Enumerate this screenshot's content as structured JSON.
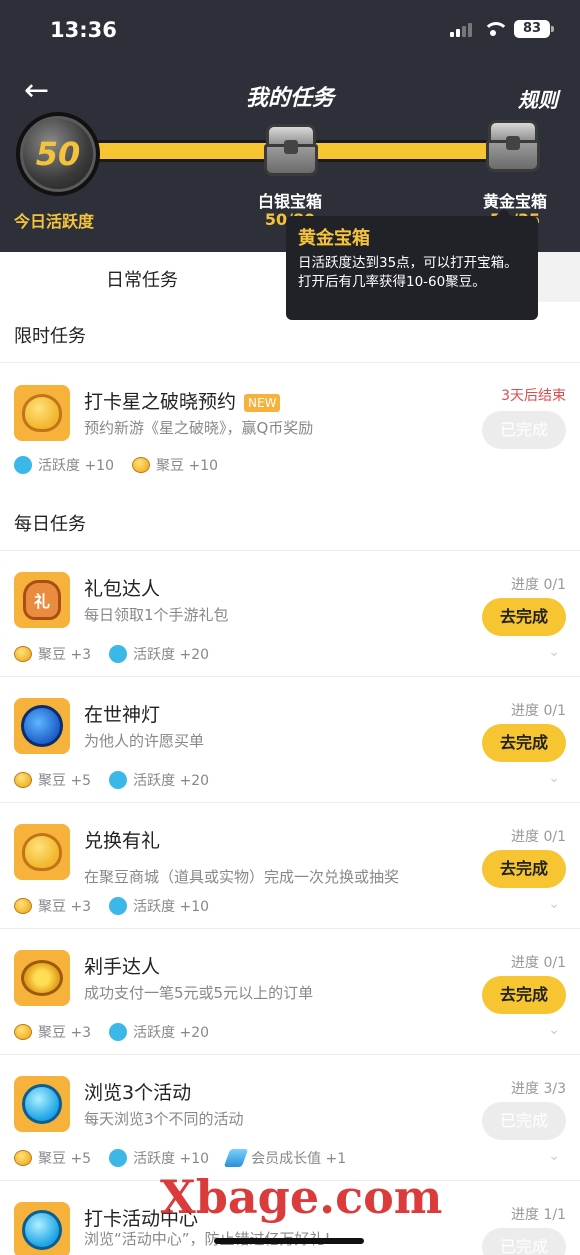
{
  "status": {
    "time": "13:36",
    "battery": "83"
  },
  "nav": {
    "back_icon": "arrow-left-icon",
    "title": "我的任务",
    "rules": "规则"
  },
  "progress_bar": {
    "level": "50",
    "level_label": "今日活跃度",
    "fill_fraction": 1.0,
    "chests": [
      {
        "label": "白银宝箱",
        "sub": "50/80"
      },
      {
        "label": "黄金宝箱",
        "sub": "56/35"
      }
    ]
  },
  "tooltip": {
    "title": "黄金宝箱",
    "body": "日活跃度达到35点，可以打开宝箱。打开后有几率获得10-60聚豆。"
  },
  "tabs": [
    {
      "label": "日常任务"
    }
  ],
  "sections": {
    "limited": "限时任务",
    "daily": "每日任务"
  },
  "limited_task": {
    "title": "打卡星之破晓预约",
    "tag": "NEW",
    "desc": "预约新游《星之破晓》，赢Q币奖励",
    "end": "3天后结束",
    "button": "已完成",
    "rewards": [
      "活跃度 +10",
      "聚豆 +10"
    ]
  },
  "daily_tasks": [
    {
      "title": "礼包达人",
      "desc": "每日领取1个手游礼包",
      "progress": "进度 0/1",
      "button": "去完成",
      "rewards": [
        "聚豆 +3",
        "活跃度 +20"
      ],
      "icon_text": "礼"
    },
    {
      "title": "在世神灯",
      "desc": "为他人的许愿买单",
      "progress": "进度 0/1",
      "button": "去完成",
      "rewards": [
        "聚豆 +5",
        "活跃度 +20"
      ]
    },
    {
      "title": "兑换有礼",
      "desc": "在聚豆商城（道具或实物）完成一次兑换或抽奖",
      "progress": "进度 0/1",
      "button": "去完成",
      "rewards": [
        "聚豆 +3",
        "活跃度 +10"
      ]
    },
    {
      "title": "剁手达人",
      "desc": "成功支付一笔5元或5元以上的订单",
      "progress": "进度 0/1",
      "button": "去完成",
      "rewards": [
        "聚豆 +3",
        "活跃度 +20"
      ]
    },
    {
      "title": "浏览3个活动",
      "desc": "每天浏览3个不同的活动",
      "progress": "进度 3/3",
      "button": "已完成",
      "rewards": [
        "聚豆 +5",
        "活跃度 +10",
        "会员成长值 +1"
      ]
    },
    {
      "title": "打卡活动中心",
      "desc": "浏览“活动中心”，防止错过亿万好礼!",
      "progress": "进度 1/1",
      "button": "已完成"
    }
  ],
  "watermark": "Xbage.com",
  "colors": {
    "header_bg": "#2d3039",
    "accent_yellow": "#f6c531",
    "red": "#e24b4b"
  }
}
